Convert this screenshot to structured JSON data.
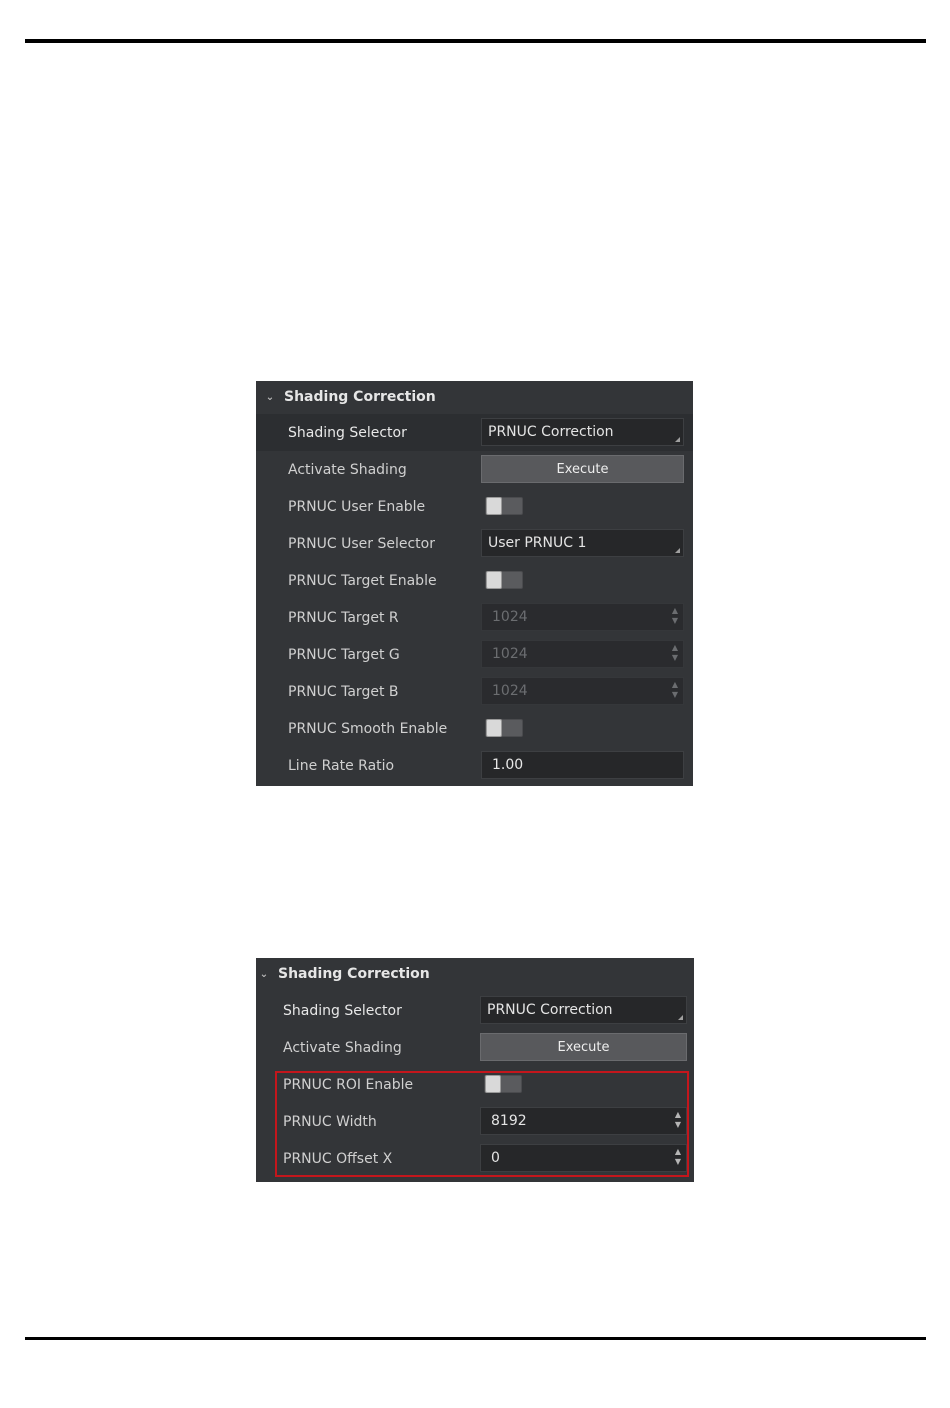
{
  "panel1": {
    "title": "Shading Correction",
    "rows": [
      {
        "label": "Shading Selector",
        "value": "PRNUC Correction"
      },
      {
        "label": "Activate Shading",
        "value": "Execute"
      },
      {
        "label": "PRNUC User Enable"
      },
      {
        "label": "PRNUC User Selector",
        "value": "User PRNUC 1"
      },
      {
        "label": "PRNUC Target Enable"
      },
      {
        "label": "PRNUC Target R",
        "value": "1024"
      },
      {
        "label": "PRNUC Target G",
        "value": "1024"
      },
      {
        "label": "PRNUC Target B",
        "value": "1024"
      },
      {
        "label": "PRNUC Smooth Enable"
      },
      {
        "label": "Line Rate Ratio",
        "value": "1.00"
      }
    ]
  },
  "panel2": {
    "title": "Shading Correction",
    "rows": [
      {
        "label": "Shading Selector",
        "value": "PRNUC Correction"
      },
      {
        "label": "Activate Shading",
        "value": "Execute"
      },
      {
        "label": "PRNUC ROI Enable"
      },
      {
        "label": "PRNUC Width",
        "value": "8192"
      },
      {
        "label": "PRNUC Offset X",
        "value": "0"
      }
    ]
  },
  "colors": {
    "panel_bg": "#333538",
    "highlight": "#c4161c"
  },
  "icons": {
    "collapse": "chevron-down-icon",
    "dropdown": "dropdown-corner-icon",
    "spin": "spin-arrows-icon"
  }
}
